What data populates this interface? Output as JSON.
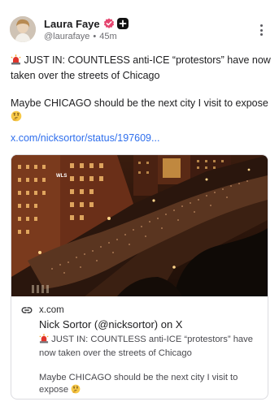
{
  "author": {
    "name": "Laura Faye",
    "handle": "@laurafaye",
    "separator": "•",
    "time": "45m"
  },
  "post": {
    "line1": "JUST IN: COUNTLESS anti-ICE “protestors” have now taken over the streets of Chicago",
    "line2": "Maybe CHICAGO should be the next city I visit to expose",
    "link": "x.com/nicksortor/status/197609..."
  },
  "card": {
    "domain": "x.com",
    "title": "Nick Sortor (@nicksortor) on X",
    "desc1": "JUST IN: COUNTLESS anti-ICE “protestors” have now taken over the streets of Chicago",
    "desc2": "Maybe CHICAGO should be the next city I visit to expose",
    "image_watermark": "WLS"
  },
  "icons": {
    "siren": "rotating-light-icon",
    "thinking": "thinking-face-icon",
    "verified": "verified-badge-icon",
    "plus": "plus-badge-icon",
    "more": "more-vertical-icon",
    "link": "link-icon"
  },
  "colors": {
    "link": "#2f6fed",
    "verified": "#e5456f"
  }
}
